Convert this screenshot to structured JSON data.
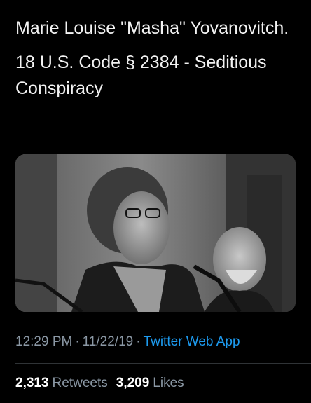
{
  "tweet": {
    "text_line1": "Marie Louise \"Masha\" Yovanovitch.",
    "text_line2": "18 U.S. Code § 2384 - Seditious Conspiracy",
    "time": "12:29 PM",
    "date": "11/22/19",
    "separator": "·",
    "source": "Twitter Web App"
  },
  "media": {
    "description_icon": "photo-icon"
  },
  "stats": {
    "retweets_count": "2,313",
    "retweets_label": "Retweets",
    "likes_count": "3,209",
    "likes_label": "Likes"
  },
  "colors": {
    "background": "#000000",
    "text": "#f2f2f2",
    "muted": "#8b98a5",
    "link": "#1d9bf0",
    "divider": "#2f3336"
  }
}
